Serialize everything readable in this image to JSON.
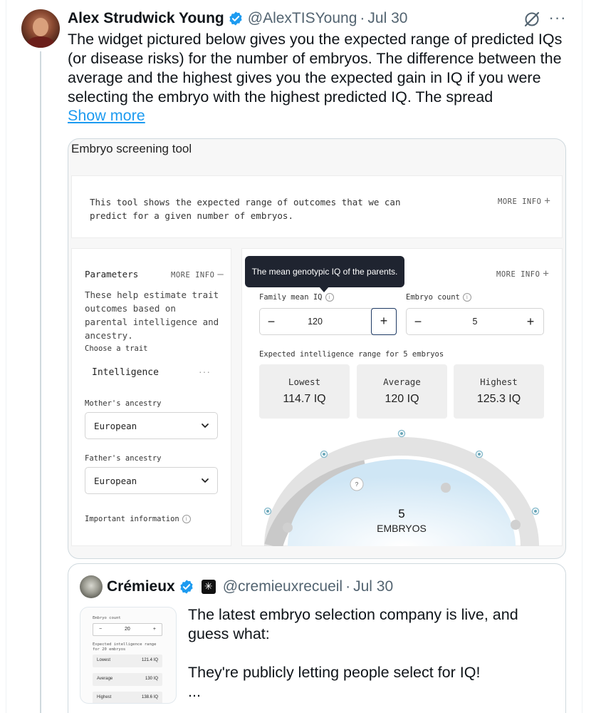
{
  "tweet": {
    "display_name": "Alex Strudwick Young",
    "handle": "@AlexTISYoung",
    "separator": "·",
    "date": "Jul 30",
    "body": "The widget pictured below gives you the expected range of predicted IQs (or disease risks) for the number of embryos. The difference between the average and the highest gives you the expected gain in IQ if you were selecting the embryo with the highest predicted IQ. The spread",
    "show_more": "Show more"
  },
  "icons": {
    "verified": "verified-badge-icon",
    "grok": "grok-icon",
    "more": "more-options-icon",
    "info": "info-icon",
    "chevron": "chevron-down-icon",
    "affiliation": "affiliation-badge-icon"
  },
  "colors": {
    "link": "#1d9bf0",
    "verified": "#1d9bf0",
    "tooltip_bg": "#1f2430",
    "stat_bg": "#efefef",
    "gauge_sky": "#cfe6f5"
  },
  "widget": {
    "title": "Embryo screening tool",
    "intro": "This tool shows the expected range of outcomes that we can predict for a given number of embryos.",
    "more_info": "MORE INFO",
    "more_info_open_sign": "+",
    "more_info_close_sign": "—",
    "params": {
      "title": "Parameters",
      "description": "These help estimate trait outcomes based on parental intelligence and ancestry.",
      "trait_label": "Choose a trait",
      "trait_value": "Intelligence",
      "trait_more": "···",
      "mother_label": "Mother's ancestry",
      "mother_value": "European",
      "father_label": "Father's ancestry",
      "father_value": "European",
      "important_info": "Important information"
    },
    "tooltip": "The mean genotypic IQ of the parents.",
    "family_iq_label": "Family mean IQ",
    "family_iq_value": "120",
    "embryo_count_label": "Embryo count",
    "embryo_count_value": "5",
    "minus": "−",
    "plus": "+",
    "range_label": "Expected intelligence range for 5 embryos",
    "stats": [
      {
        "name": "Lowest",
        "value": "114.7 IQ"
      },
      {
        "name": "Average",
        "value": "120 IQ"
      },
      {
        "name": "Highest",
        "value": "125.3 IQ"
      }
    ],
    "gauge_count": "5",
    "gauge_unit": "EMBRYOS",
    "gauge_handle": "?"
  },
  "quote": {
    "display_name": "Crémieux",
    "handle": "@cremieuxrecueil",
    "separator": "·",
    "date": "Jul 30",
    "text_line1": "The latest embryo selection company is live, and guess what:",
    "text_line2": "They're publicly letting people select for IQ!",
    "ellipsis": "...",
    "thumb": {
      "count_label": "Embryo count",
      "minus": "−",
      "count": "20",
      "plus": "+",
      "range_label": "Expected intelligence range for 20 embryos",
      "rows": [
        {
          "name": "Lowest",
          "value": "121.4 IQ"
        },
        {
          "name": "Average",
          "value": "130 IQ"
        },
        {
          "name": "Highest",
          "value": "138.6 IQ"
        }
      ]
    }
  }
}
